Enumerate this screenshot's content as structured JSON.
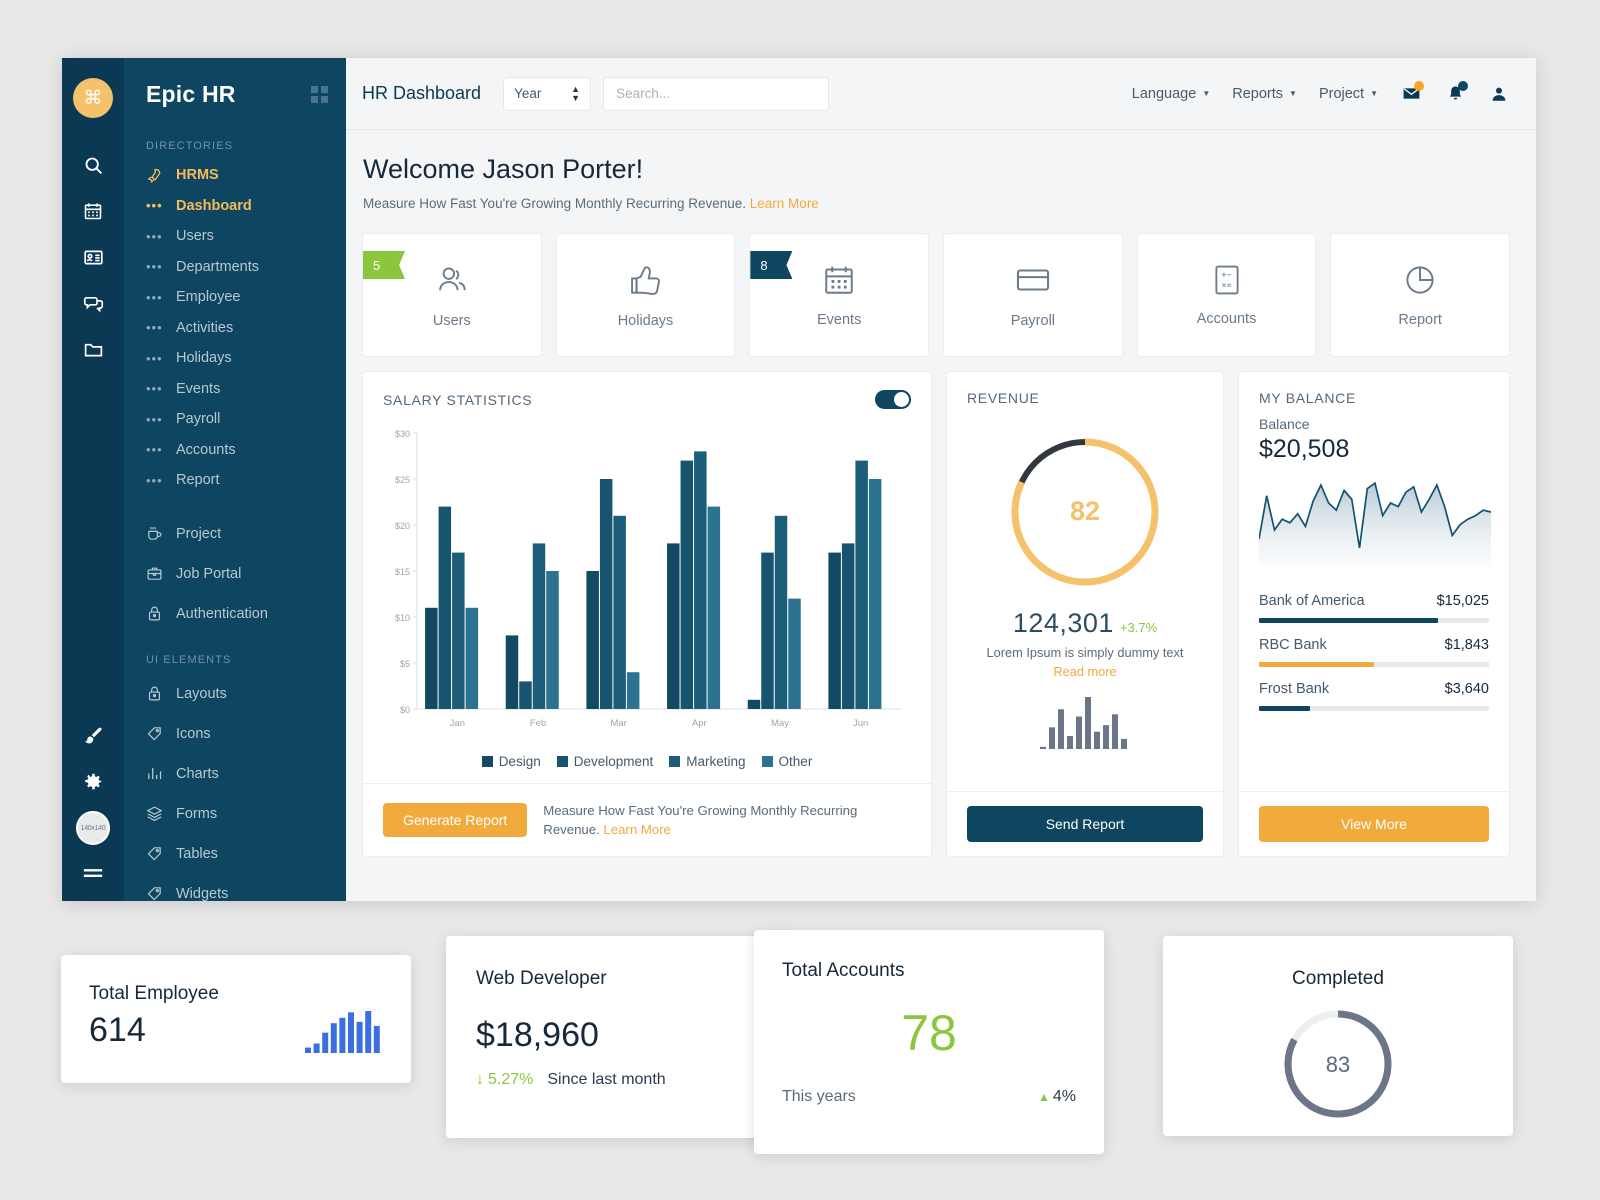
{
  "rail": {
    "logo_glyph": "⌘",
    "icons": [
      "search-icon",
      "calendar-icon",
      "id-card-icon",
      "chat-icon",
      "folder-icon"
    ],
    "bottom_icons": [
      "brush-icon",
      "gear-icon"
    ],
    "avatar_label": "140x140",
    "menu_icon": "hamburger-icon"
  },
  "sidebar": {
    "title": "Epic HR",
    "grid_icon": "grid-icon",
    "sections": [
      {
        "label": "DIRECTORIES",
        "items": [
          {
            "label": "HRMS",
            "icon": "rocket-icon",
            "accent": true
          },
          {
            "label": "Dashboard",
            "icon": "dots-icon",
            "accent": true
          },
          {
            "label": "Users",
            "icon": "dots-icon",
            "accent": false
          },
          {
            "label": "Departments",
            "icon": "dots-icon",
            "accent": false
          },
          {
            "label": "Employee",
            "icon": "dots-icon",
            "accent": false
          },
          {
            "label": "Activities",
            "icon": "dots-icon",
            "accent": false
          },
          {
            "label": "Holidays",
            "icon": "dots-icon",
            "accent": false
          },
          {
            "label": "Events",
            "icon": "dots-icon",
            "accent": false
          },
          {
            "label": "Payroll",
            "icon": "dots-icon",
            "accent": false
          },
          {
            "label": "Accounts",
            "icon": "dots-icon",
            "accent": false
          },
          {
            "label": "Report",
            "icon": "dots-icon",
            "accent": false
          }
        ]
      },
      {
        "label": "",
        "items": [
          {
            "label": "Project",
            "icon": "coffee-icon",
            "accent": false
          },
          {
            "label": "Job Portal",
            "icon": "briefcase-icon",
            "accent": false
          },
          {
            "label": "Authentication",
            "icon": "lock-icon",
            "accent": false
          }
        ]
      },
      {
        "label": "UI ELEMENTS",
        "items": [
          {
            "label": "Layouts",
            "icon": "lock-icon",
            "accent": false
          },
          {
            "label": "Icons",
            "icon": "tag-icon",
            "accent": false
          },
          {
            "label": "Charts",
            "icon": "bar-chart-icon",
            "accent": false
          },
          {
            "label": "Forms",
            "icon": "layers-icon",
            "accent": false
          },
          {
            "label": "Tables",
            "icon": "tag-icon",
            "accent": false
          },
          {
            "label": "Widgets",
            "icon": "tag-icon",
            "accent": false
          }
        ]
      }
    ]
  },
  "topbar": {
    "page_title": "HR Dashboard",
    "period_select": {
      "value": "Year",
      "icon": "updown-caret-icon"
    },
    "search_placeholder": "Search...",
    "nav": [
      {
        "label": "Language",
        "icon": "caret-down-icon"
      },
      {
        "label": "Reports",
        "icon": "caret-down-icon"
      },
      {
        "label": "Project",
        "icon": "caret-down-icon"
      }
    ],
    "mail_icon": "envelope-icon",
    "mail_badge_color": "#f5a623",
    "bell_icon": "bell-icon",
    "bell_badge_color": "#0e4560",
    "user_icon": "user-icon"
  },
  "welcome": {
    "heading": "Welcome Jason Porter!",
    "subtitle": "Measure How Fast You're Growing Monthly Recurring Revenue.",
    "link": "Learn More"
  },
  "tiles": [
    {
      "label": "Users",
      "icon": "users-icon",
      "badge": "5",
      "badge_color": "#8cc63f"
    },
    {
      "label": "Holidays",
      "icon": "thumbsup-icon",
      "badge": "",
      "badge_color": ""
    },
    {
      "label": "Events",
      "icon": "calendar-icon",
      "badge": "8",
      "badge_color": "#0e4560"
    },
    {
      "label": "Payroll",
      "icon": "card-icon",
      "badge": "",
      "badge_color": ""
    },
    {
      "label": "Accounts",
      "icon": "calculator-icon",
      "badge": "",
      "badge_color": ""
    },
    {
      "label": "Report",
      "icon": "pie-icon",
      "badge": "",
      "badge_color": ""
    }
  ],
  "salary": {
    "title": "SALARY STATISTICS",
    "toggle_on": true,
    "footer_button": "Generate Report",
    "footer_text": "Measure How Fast You're Growing Monthly Recurring",
    "footer_text2": "Revenue.",
    "footer_link": "Learn More"
  },
  "revenue": {
    "title": "REVENUE",
    "gauge_value": "82",
    "gauge_percent": 82,
    "gauge_color": "#f6c16b",
    "gauge_track": "#333840",
    "amount": "124,301",
    "change": "+3.7%",
    "caption": "Lorem Ipsum is simply dummy text",
    "read_more": "Read more",
    "button": "Send Report",
    "spark_bars": [
      3,
      30,
      55,
      18,
      45,
      72,
      24,
      33,
      48,
      14
    ]
  },
  "balance": {
    "title": "MY BALANCE",
    "label": "Balance",
    "amount": "$20,508",
    "banks": [
      {
        "name": "Bank of America",
        "value": "$15,025",
        "percent": 78,
        "color": "#0e4560"
      },
      {
        "name": "RBC Bank",
        "value": "$1,843",
        "percent": 50,
        "color": "#f0ab3c"
      },
      {
        "name": "Frost Bank",
        "value": "$3,640",
        "percent": 22,
        "color": "#0e4560"
      }
    ],
    "button": "View More"
  },
  "bottom_cards": {
    "total_employee": {
      "title": "Total Employee",
      "value": "614",
      "bars": [
        8,
        14,
        30,
        44,
        52,
        60,
        46,
        62,
        40
      ]
    },
    "web_developer": {
      "title": "Web Developer",
      "value": "$18,960",
      "delta": "5.27%",
      "delta_icon": "arrow-down-icon",
      "note": "Since last month"
    },
    "total_accounts": {
      "title": "Total Accounts",
      "value": "78",
      "footer": "This years",
      "delta": "4%",
      "delta_icon": "arrow-up-icon"
    },
    "completed": {
      "title": "Completed",
      "value": "83",
      "percent": 83,
      "color": "#6b7689",
      "track": "#eceef0"
    }
  },
  "chart_data": {
    "type": "bar",
    "title": "SALARY STATISTICS",
    "categories": [
      "Jan",
      "Feb",
      "Mar",
      "Apr",
      "May",
      "Jun"
    ],
    "series": [
      {
        "name": "Design",
        "color": "#134a63",
        "values": [
          11,
          8,
          15,
          18,
          1,
          17
        ]
      },
      {
        "name": "Development",
        "color": "#17546f",
        "values": [
          22,
          3,
          25,
          27,
          17,
          18
        ]
      },
      {
        "name": "Marketing",
        "color": "#1c5e7a",
        "values": [
          17,
          18,
          21,
          28,
          21,
          27
        ]
      },
      {
        "name": "Other",
        "color": "#2c7291",
        "values": [
          11,
          15,
          4,
          22,
          12,
          25
        ]
      }
    ],
    "ylabel": "",
    "xlabel": "",
    "ylim": [
      0,
      30
    ],
    "yticks": [
      "$0",
      "$5",
      "$10",
      "$15",
      "$20",
      "$25",
      "$30"
    ],
    "grid": false,
    "legend_position": "bottom"
  }
}
